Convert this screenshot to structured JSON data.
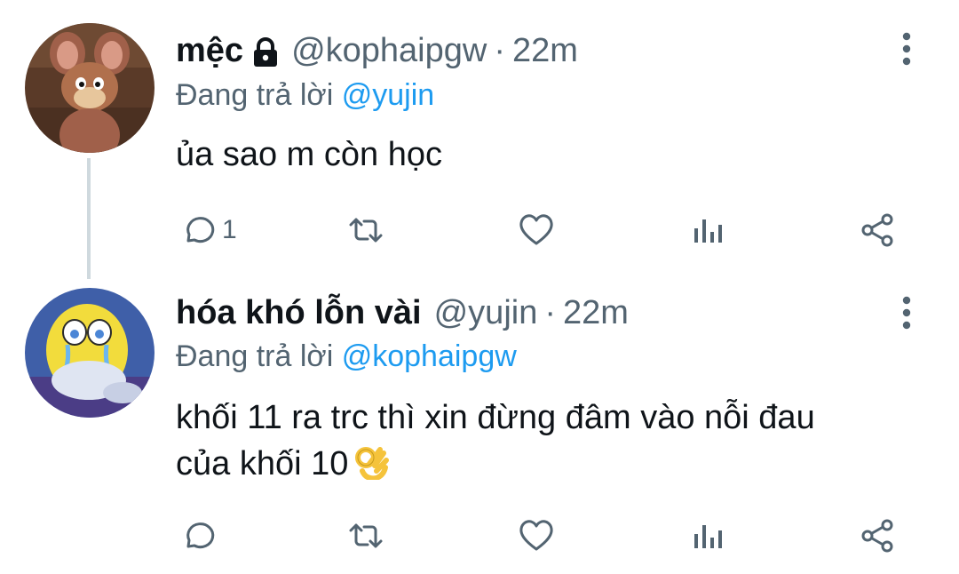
{
  "tweets": [
    {
      "name": "mệc",
      "handle": "@kophaipgw",
      "separator": "·",
      "time": "22m",
      "replying_prefix": "Đang trả lời",
      "replying_to": "@yujin",
      "text": "ủa sao m còn học",
      "reply_count": "1",
      "locked": true
    },
    {
      "name": "hóa khó lỗn vài",
      "handle": "@yujin",
      "separator": "·",
      "time": "22m",
      "replying_prefix": "Đang trả lời",
      "replying_to": "@kophaipgw",
      "text_line1": "khối 11 ra trc thì xin đừng đâm vào nỗi đau",
      "text_line2": "của khối 10",
      "emoji": "ok-hand-emoji"
    }
  ],
  "icons": {
    "reply": "reply-icon",
    "retweet": "retweet-icon",
    "like": "heart-icon",
    "analytics": "analytics-icon",
    "share": "share-icon",
    "more": "more-vertical-icon",
    "lock": "lock-icon"
  },
  "colors": {
    "text": "#0f1419",
    "secondary": "#536471",
    "mention": "#1d9bf0",
    "thread_line": "#cfd9de"
  }
}
